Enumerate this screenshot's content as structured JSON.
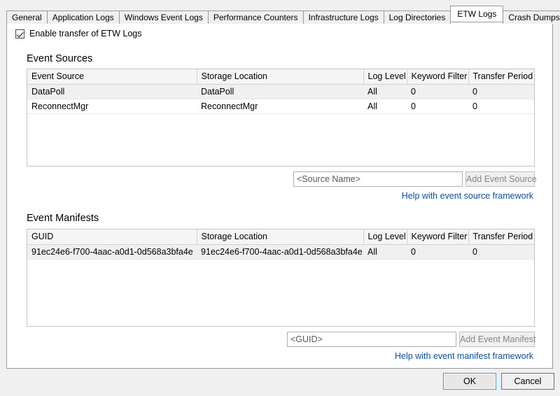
{
  "window": {
    "tabs": [
      {
        "label": "General",
        "active": false
      },
      {
        "label": "Application Logs",
        "active": false
      },
      {
        "label": "Windows Event Logs",
        "active": false
      },
      {
        "label": "Performance Counters",
        "active": false
      },
      {
        "label": "Infrastructure Logs",
        "active": false
      },
      {
        "label": "Log Directories",
        "active": false
      },
      {
        "label": "ETW Logs",
        "active": true
      },
      {
        "label": "Crash Dumps",
        "active": false
      }
    ]
  },
  "enable_checkbox": {
    "label": "Enable transfer of ETW Logs",
    "checked": true
  },
  "event_sources": {
    "title": "Event Sources",
    "columns": [
      "Event Source",
      "Storage Location",
      "Log Level",
      "Keyword Filter",
      "Transfer Period (min)"
    ],
    "rows": [
      [
        "DataPoll",
        "DataPoll",
        "All",
        "0",
        "0"
      ],
      [
        "ReconnectMgr",
        "ReconnectMgr",
        "All",
        "0",
        "0"
      ]
    ],
    "input_placeholder": "<Source Name>",
    "input_value": "",
    "add_button": "Add Event Source",
    "add_button_enabled": false,
    "help_link": "Help with event source framework"
  },
  "event_manifests": {
    "title": "Event Manifests",
    "columns": [
      "GUID",
      "Storage Location",
      "Log Level",
      "Keyword Filter",
      "Transfer Period (min)"
    ],
    "rows": [
      [
        "91ec24e6-f700-4aac-a0d1-0d568a3bfa4e",
        "91ec24e6-f700-4aac-a0d1-0d568a3bfa4e",
        "All",
        "0",
        "0"
      ]
    ],
    "input_placeholder": "<GUID>",
    "input_value": "",
    "add_button": "Add Event Manifest",
    "add_button_enabled": false,
    "help_link": "Help with event manifest framework"
  },
  "footer": {
    "ok_label": "OK",
    "cancel_label": "Cancel"
  },
  "colors": {
    "accent": "#0b4ea2",
    "focus_border": "#3a9ade",
    "panel_bg": "#ffffff",
    "window_bg": "#f0f0f0"
  }
}
